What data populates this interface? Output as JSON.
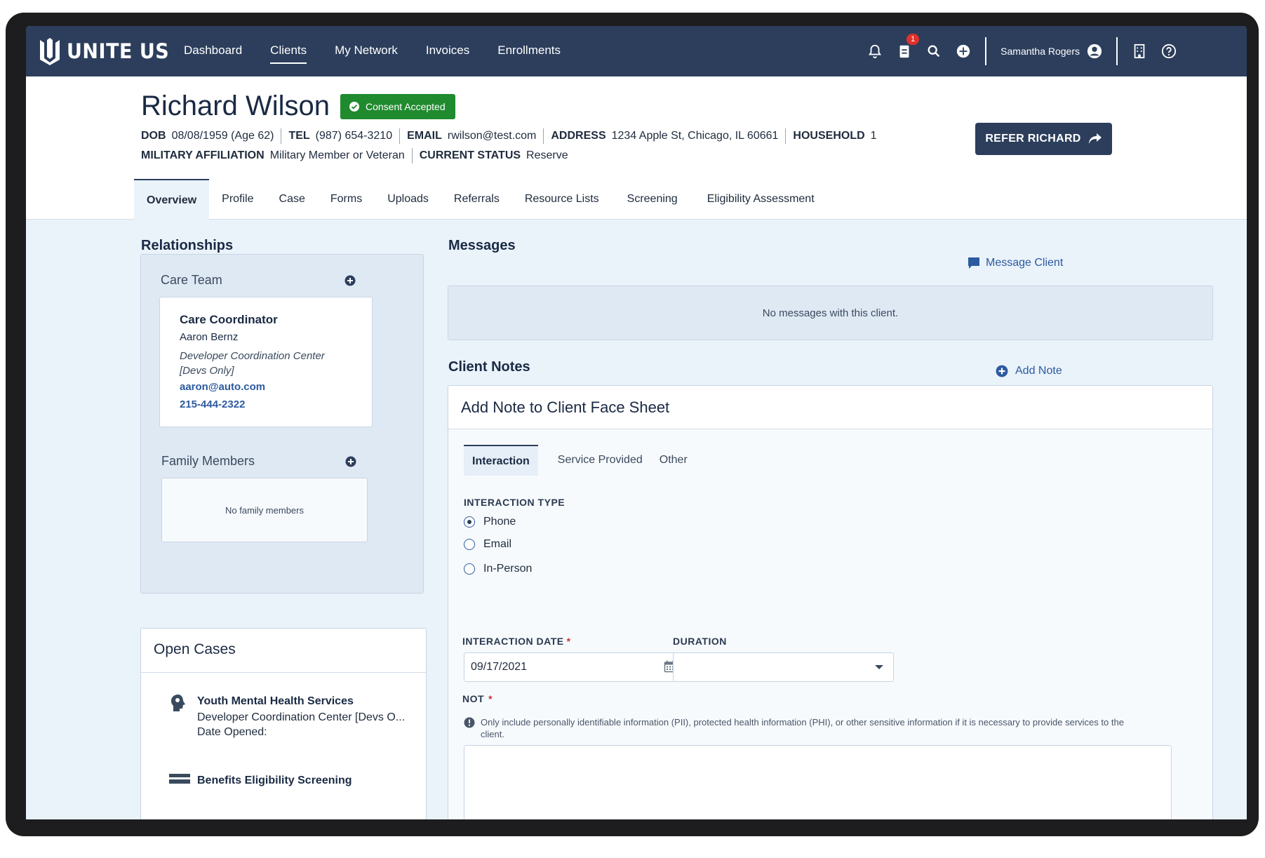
{
  "nav": {
    "logo_text": "UNITE US",
    "links": [
      "Dashboard",
      "Clients",
      "My Network",
      "Invoices",
      "Enrollments"
    ],
    "active_link": "Clients",
    "notification_count": "1",
    "user_name": "Samantha Rogers"
  },
  "client": {
    "name": "Richard Wilson",
    "consent_label": "Consent Accepted",
    "dob_label": "DOB",
    "dob": "08/08/1959 (Age 62)",
    "tel_label": "TEL",
    "tel": "(987) 654-3210",
    "email_label": "EMAIL",
    "email": "rwilson@test.com",
    "address_label": "ADDRESS",
    "address": "1234 Apple St, Chicago, IL 60661",
    "household_label": "HOUSEHOLD",
    "household": "1",
    "military_label": "MILITARY AFFILIATION",
    "military": "Military Member or Veteran",
    "status_label": "CURRENT STATUS",
    "status": "Reserve",
    "refer_label": "REFER RICHARD"
  },
  "tabs": [
    "Overview",
    "Profile",
    "Case",
    "Forms",
    "Uploads",
    "Referrals",
    "Resource Lists",
    "Screening",
    "Eligibility Assessment"
  ],
  "relationships": {
    "title": "Relationships",
    "care_team_label": "Care Team",
    "coordinator_role": "Care Coordinator",
    "coordinator_name": "Aaron Bernz",
    "coordinator_org": "Developer Coordination Center [Devs Only]",
    "coordinator_email": "aaron@auto.com",
    "coordinator_phone": "215-444-2322",
    "family_label": "Family Members",
    "family_empty": "No family members"
  },
  "open_cases": {
    "title": "Open Cases",
    "items": [
      {
        "name": "Youth Mental Health Services",
        "org": "Developer Coordination Center [Devs O...",
        "date_label": "Date Opened:"
      },
      {
        "name": "Benefits Eligibility Screening"
      }
    ]
  },
  "messages": {
    "title": "Messages",
    "link_label": "Message Client",
    "empty": "No messages with this client."
  },
  "client_notes": {
    "title": "Client Notes",
    "add_label": "Add Note",
    "panel_title": "Add Note to Client Face Sheet",
    "note_tabs": [
      "Interaction",
      "Service Provided",
      "Other"
    ],
    "interaction_type_label": "INTERACTION TYPE",
    "interaction_options": [
      "Phone",
      "Email",
      "In-Person"
    ],
    "selected_option": "Phone",
    "date_label": "INTERACTION DATE",
    "date_value": "09/17/2021",
    "duration_label": "DURATION",
    "duration_value": "",
    "note_label": "NOT",
    "pii_warning": "Only include personally identifiable information (PII), protected health information (PHI), or other sensitive information if it is necessary to provide services to the client.",
    "required_mark": "*"
  },
  "colors": {
    "nav_bg": "#2c3e5c",
    "consent_bg": "#1f8a2e",
    "page_bg": "#eaf2fa",
    "link": "#2c5aa0",
    "badge": "#e0312b"
  }
}
